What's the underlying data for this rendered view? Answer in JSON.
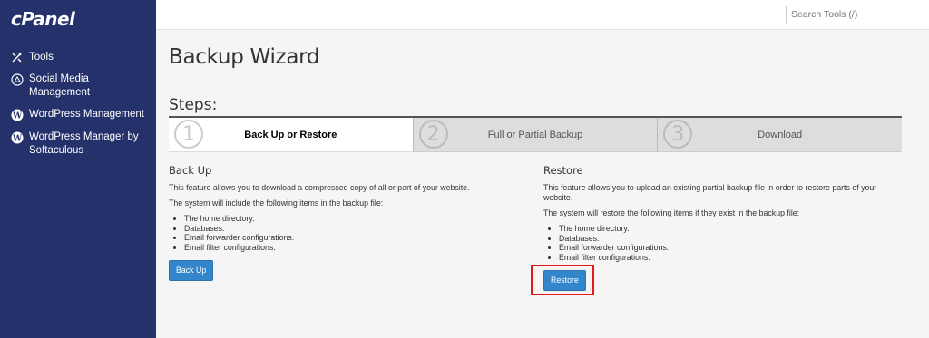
{
  "sidebar": {
    "logo": "cPanel",
    "items": [
      {
        "label": "Tools",
        "icon": "tools-icon"
      },
      {
        "label": "Social Media Management",
        "icon": "social-media-icon"
      },
      {
        "label": "WordPress Management",
        "icon": "wordpress-icon"
      },
      {
        "label": "WordPress Manager by Softaculous",
        "icon": "wordpress-icon"
      }
    ]
  },
  "header": {
    "search_placeholder": "Search Tools (/)"
  },
  "main": {
    "title": "Backup Wizard",
    "steps_heading": "Steps:",
    "steps": [
      {
        "number": "1",
        "label": "Back Up or Restore",
        "active": true
      },
      {
        "number": "2",
        "label": "Full or Partial Backup",
        "active": false
      },
      {
        "number": "3",
        "label": "Download",
        "active": false
      }
    ],
    "backup": {
      "heading": "Back Up",
      "desc": "This feature allows you to download a compressed copy of all or part of your website.",
      "list_intro": "The system will include the following items in the backup file:",
      "items": [
        "The home directory.",
        "Databases.",
        "Email forwarder configurations.",
        "Email filter configurations."
      ],
      "button": "Back Up"
    },
    "restore": {
      "heading": "Restore",
      "desc": "This feature allows you to upload an existing partial backup file in order to restore parts of your website.",
      "list_intro": "The system will restore the following items if they exist in the backup file:",
      "items": [
        "The home directory.",
        "Databases.",
        "Email forwarder configurations.",
        "Email filter configurations."
      ],
      "button": "Restore"
    }
  },
  "colors": {
    "sidebar_bg": "#25316b",
    "button_bg": "#3386cc",
    "highlight": "#e0191c"
  }
}
